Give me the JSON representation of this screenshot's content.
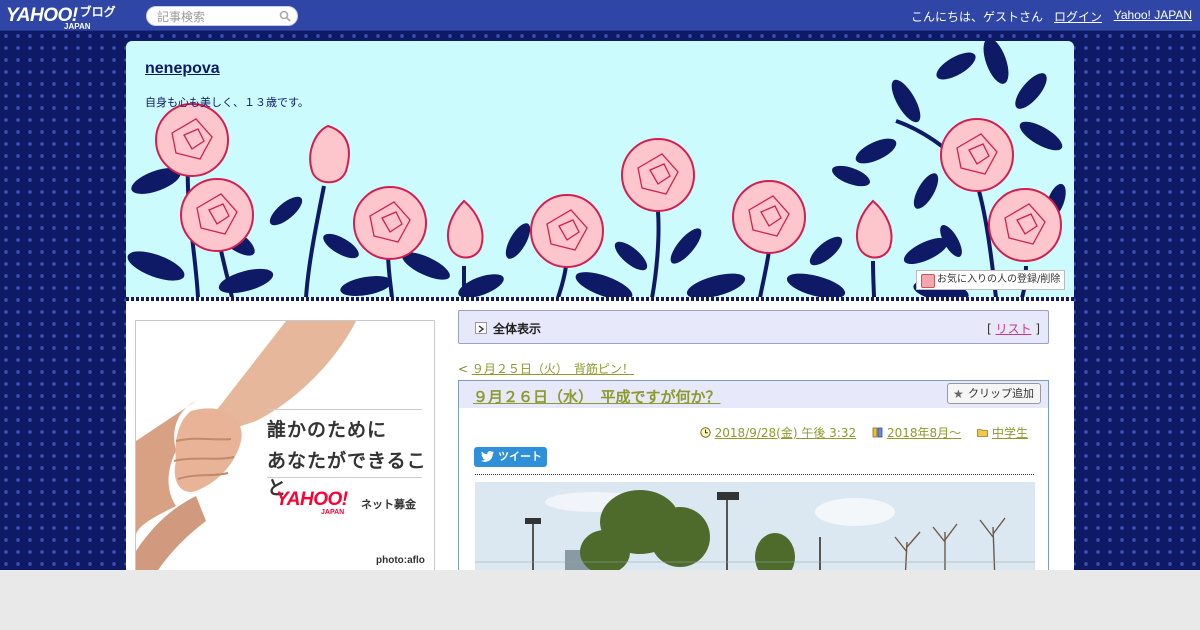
{
  "topbar": {
    "logo_text": "YAHOO!",
    "logo_sub": "JAPAN",
    "blog_label": "ブログ",
    "search_placeholder": "記事検索",
    "greeting": "こんにちは、ゲストさん",
    "login_label": "ログイン",
    "yahoo_japan_label": "Yahoo! JAPAN"
  },
  "header": {
    "blog_title": "nenepova",
    "description": "自身も心も美しく、１３歳です。",
    "favorite_button": "お気に入りの人の登録/削除"
  },
  "ad": {
    "line1": "誰かのために",
    "line2": "あなたができること",
    "brand": "YAHOO!",
    "brand_sub": "JAPAN",
    "service": "ネット募金",
    "credit": "photo:aflo"
  },
  "view_bar": {
    "label": "全体表示",
    "list_label": "リスト"
  },
  "prev_link": {
    "prefix": "<",
    "label": "９月２５日（火）　背筋ピン！"
  },
  "article": {
    "title": "９月２６日（水）　平成ですが何か？",
    "clip_label": "クリップ追加",
    "date": "2018/9/28(金) 午後 3:32",
    "archive": "2018年8月～",
    "category": "中学生",
    "tweet_label": "ツイート"
  },
  "colors": {
    "navy": "#0e1a66",
    "topbar": "#2f46a6",
    "header_bg": "#ccfbfd",
    "link_olive": "#8c9a2e",
    "rose_fill": "#fdc6cd",
    "rose_stroke": "#d21f4f"
  }
}
